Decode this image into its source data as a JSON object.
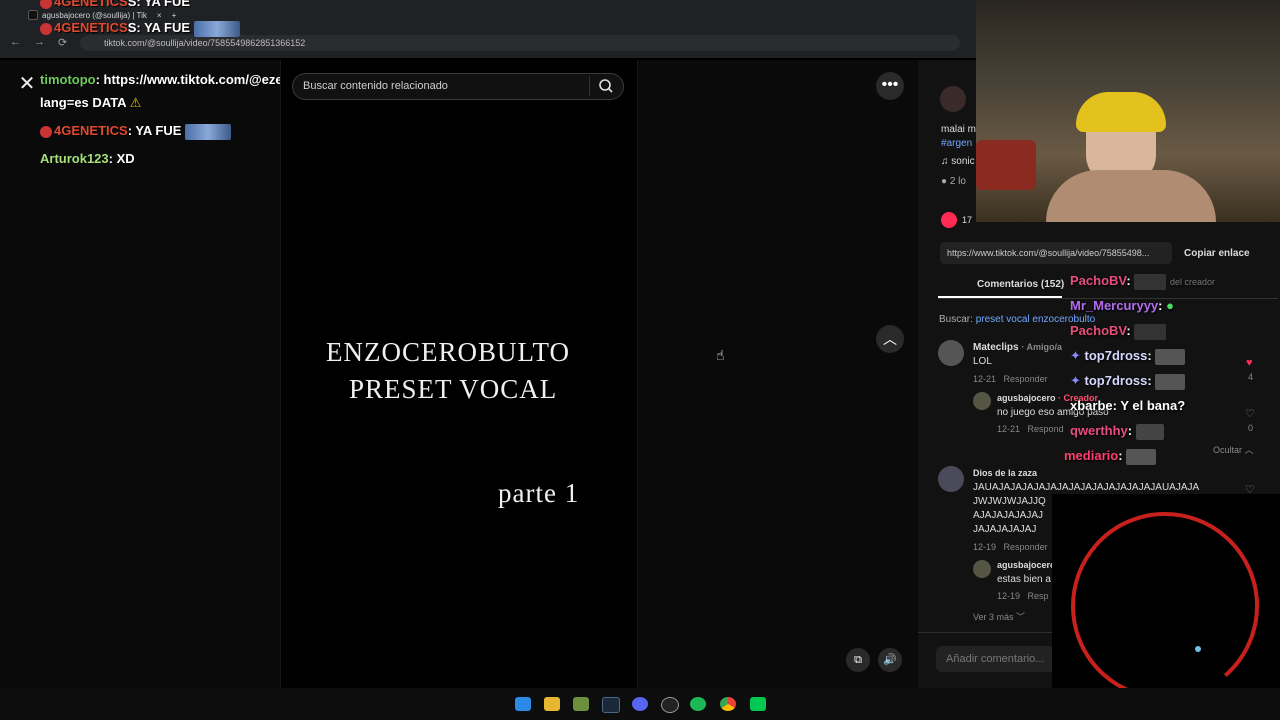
{
  "browser": {
    "tab_title": "agusbajocero (@soullija) | Tik",
    "url": "tiktok.com/@soullija/video/7585549862851366152"
  },
  "left_chat": [
    {
      "user": "timotopo",
      "user_color": "#6ecb5c",
      "text": ": https://www.tiktok.com/@ezewkiel/vi"
    },
    {
      "text": "lang=es DATA"
    },
    {
      "user": "4GENETICS",
      "user_color": "#e0492f",
      "text": ": YA FUE"
    },
    {
      "user": "Arturok123",
      "user_color": "#a5e07a",
      "text": ": XD"
    }
  ],
  "top_chat_ghost": [
    {
      "user": "4GENETICS",
      "text": "S: YA FUE"
    },
    {
      "user": "4GENETICS",
      "text": "S: YA FUE"
    }
  ],
  "search": {
    "placeholder": "Buscar contenido relacionado"
  },
  "video": {
    "line1": "ENZOCEROBULTO",
    "line2": "PRESET VOCAL",
    "line3": "parte 1"
  },
  "right_panel": {
    "caption_user": "malai m",
    "caption_tag": "#argen",
    "sound": "sonic",
    "likes_small": "2 lo",
    "likes_count": "17",
    "link": "https://www.tiktok.com/@soullija/video/75855498...",
    "copy_link": "Copiar enlace",
    "comments_tab": "Comentarios (152)",
    "search_label": "Buscar:",
    "search_term": "preset vocal enzocerobulto",
    "comments": [
      {
        "user": "Mateclips",
        "tag": "· Amigo/a",
        "text": "LOL",
        "date": "12-21",
        "reply": "Responder"
      },
      {
        "user": "agusbajocero",
        "tag": "· Creador",
        "text": "no juego eso amigo paso",
        "date": "12-21",
        "reply": "Respond"
      },
      {
        "user": "Dios de la zaza",
        "text": "JAUAJAJAJAJAJAJAJAJAJAJAJAJAJAJAUAJAJA",
        "text2": "JWJWJWJAJJQ",
        "text3": "AJAJAJAJAJAJ",
        "text4": "JAJAJAJAJAJ",
        "date": "12-19",
        "reply": "Responder"
      },
      {
        "user": "agusbajocero",
        "text": "estas bien a",
        "date": "12-19",
        "reply": "Resp"
      }
    ],
    "like_counts": [
      "4",
      "0"
    ],
    "hide": "Ocultar",
    "see_more": "Ver 3 más",
    "add_comment": "Añadir comentario..."
  },
  "right_chat": [
    {
      "user": "PachoBV",
      "color": "#e84d7d",
      "text": ":"
    },
    {
      "user": "Mr_Mercuryyy",
      "color": "#b36cf0",
      "text": ":"
    },
    {
      "user": "PachoBV",
      "color": "#e84d7d",
      "text": ":"
    },
    {
      "user": "top7dross",
      "color": "#d8d8ff",
      "text": ":"
    },
    {
      "user": "top7dross",
      "color": "#d8d8ff",
      "text": ":"
    },
    {
      "user": "xbarbe",
      "color": "#ffffff",
      "text": ": Y el bana?"
    },
    {
      "user": "qwerthhy",
      "color": "#e84d7d",
      "text": ":"
    },
    {
      "user": "mediario",
      "color": "#ff3d6e",
      "text": ":"
    }
  ],
  "ghost_label": "del creador",
  "icons": {
    "close": "close-icon",
    "more": "more-options-icon",
    "search": "search-icon",
    "up": "chevron-up-icon",
    "volume": "volume-icon",
    "pip": "picture-in-picture-icon"
  }
}
